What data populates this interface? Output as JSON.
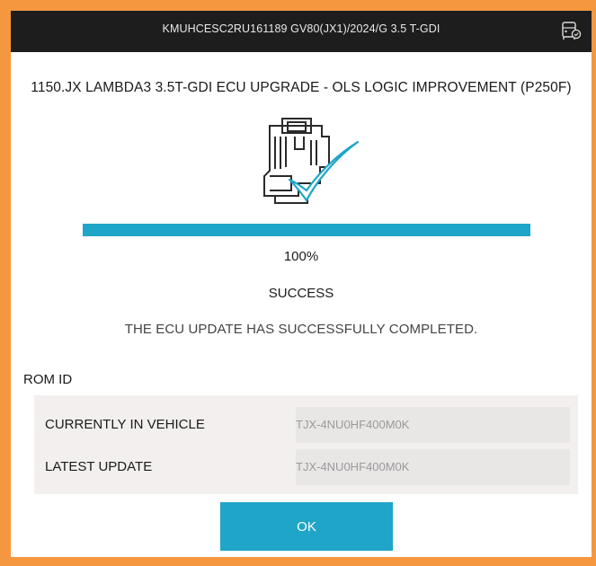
{
  "header": {
    "vehicle_info": "KMUHCESC2RU161189  GV80(JX1)/2024/G 3.5 T-GDI",
    "vehicle_icon": "vehicle-status-icon"
  },
  "update": {
    "title": "1150.JX LAMBDA3 3.5T-GDI ECU UPGRADE - OLS LOGIC IMPROVEMENT (P250F)",
    "illustration_icon": "ecu-check-icon",
    "progress_percent": 100,
    "progress_text": "100%",
    "status": "SUCCESS",
    "message": "THE ECU UPDATE HAS SUCCESSFULLY COMPLETED."
  },
  "rom": {
    "section_label": "ROM ID",
    "rows": [
      {
        "label": "CURRENTLY IN VEHICLE",
        "value": "TJX-4NU0HF400M0K"
      },
      {
        "label": "LATEST UPDATE",
        "value": "TJX-4NU0HF400M0K"
      }
    ]
  },
  "actions": {
    "ok_label": "OK"
  },
  "colors": {
    "accent": "#1fa5c8",
    "header_bg": "#1d1d1d",
    "frame_border": "#f5973f"
  }
}
